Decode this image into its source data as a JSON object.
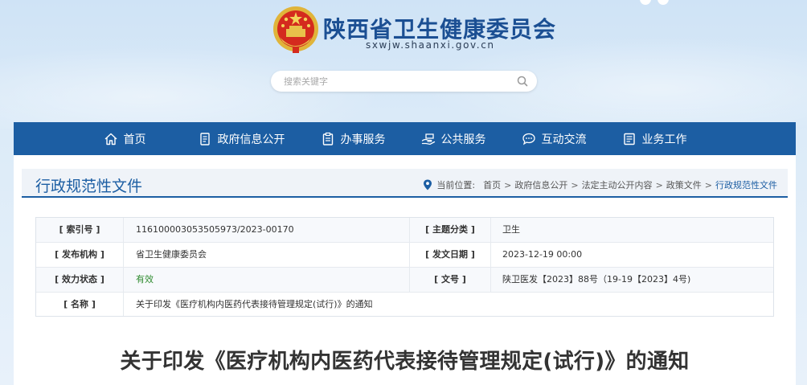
{
  "site": {
    "title": "陕西省卫生健康委员会",
    "domain": "sxwjw.shaanxi.gov.cn"
  },
  "search": {
    "placeholder": "搜索关键字"
  },
  "nav": {
    "items": [
      {
        "label": "首页",
        "icon": "home-icon"
      },
      {
        "label": "政府信息公开",
        "icon": "document-icon"
      },
      {
        "label": "办事服务",
        "icon": "clipboard-icon"
      },
      {
        "label": "公共服务",
        "icon": "hands-icon"
      },
      {
        "label": "互动交流",
        "icon": "chat-icon"
      },
      {
        "label": "业务工作",
        "icon": "folder-icon"
      }
    ]
  },
  "section": {
    "title": "行政规范性文件",
    "location_label": "当前位置:",
    "breadcrumb": [
      "首页",
      "政府信息公开",
      "法定主动公开内容",
      "政策文件",
      "行政规范性文件"
    ]
  },
  "meta": {
    "index_label": "[ 索引号 ]",
    "index_value": "116100003053505973/2023-00170",
    "topic_label": "[ 主题分类 ]",
    "topic_value": "卫生",
    "publisher_label": "[ 发布机构 ]",
    "publisher_value": "省卫生健康委员会",
    "date_label": "[ 发文日期 ]",
    "date_value": "2023-12-19 00:00",
    "status_label": "[ 效力状态 ]",
    "status_value": "有效",
    "docno_label": "[ 文号 ]",
    "docno_value": "陕卫医发【2023】88号（19-19【2023】4号)",
    "name_label": "[ 名称 ]",
    "name_value": "关于印发《医疗机构内医药代表接待管理规定(试行)》的通知"
  },
  "document": {
    "title": "关于印发《医疗机构内医药代表接待管理规定(试行)》的通知"
  },
  "colors": {
    "brand_blue": "#1c5ea3",
    "status_green": "#2e8b2e"
  }
}
